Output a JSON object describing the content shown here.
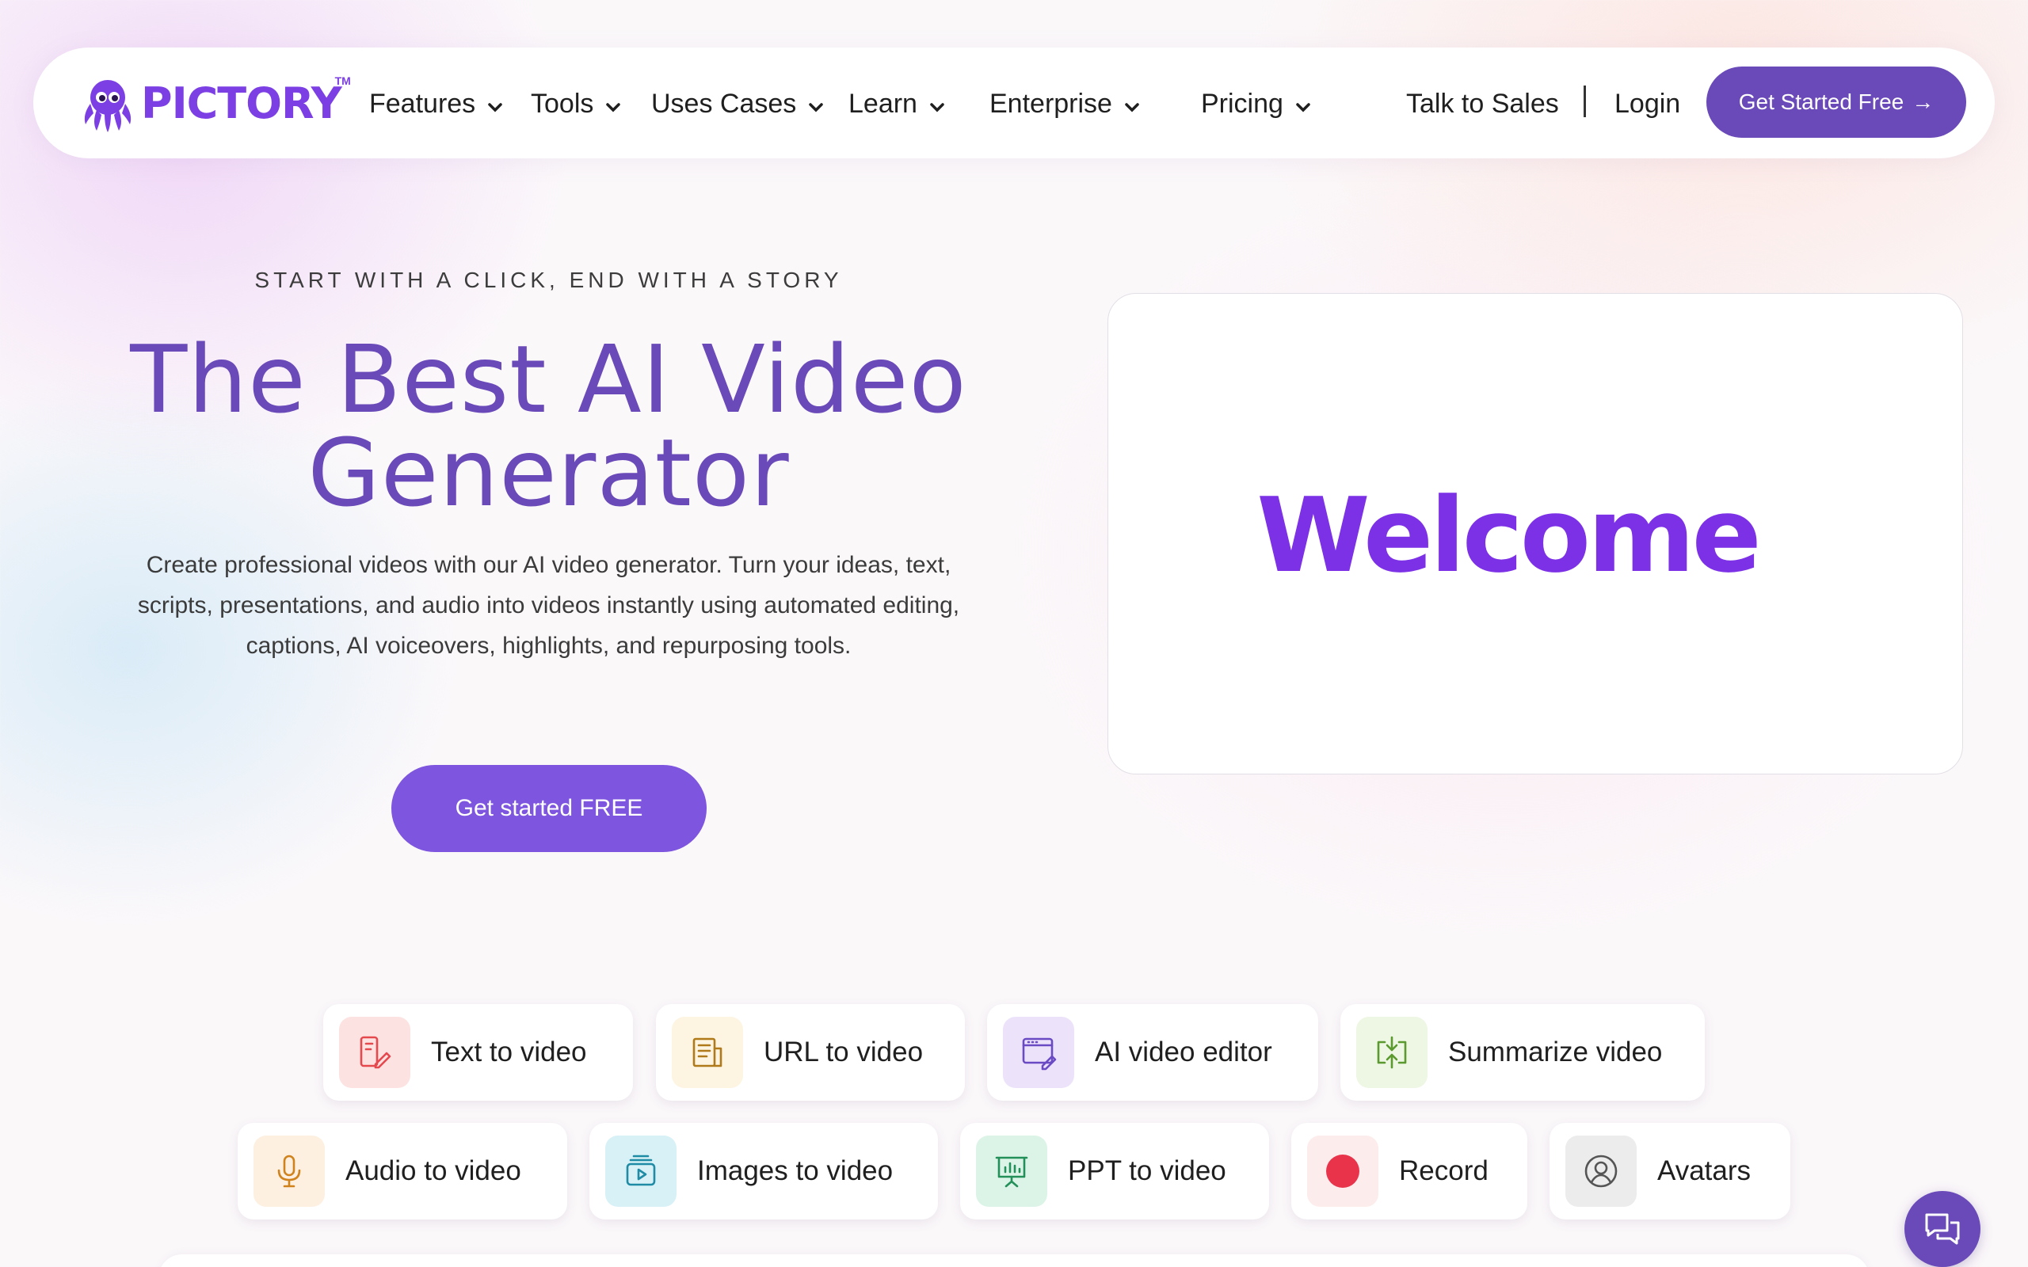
{
  "nav": {
    "logo_text": "PICTORY",
    "logo_tm": "TM",
    "menu": [
      {
        "label": "Features",
        "icon": "chevron-down-icon"
      },
      {
        "label": "Tools",
        "icon": "chevron-down-icon"
      },
      {
        "label": "Uses Cases",
        "icon": "chevron-down-icon"
      },
      {
        "label": "Learn",
        "icon": "chevron-down-icon"
      },
      {
        "label": "Enterprise",
        "icon": "chevron-down-icon"
      },
      {
        "label": "Pricing",
        "icon": "chevron-down-icon"
      }
    ],
    "talk_to_sales": "Talk to Sales",
    "login": "Login",
    "cta": "Get Started Free",
    "cta_arrow": "→"
  },
  "hero": {
    "eyebrow": "START WITH A CLICK, END WITH A STORY",
    "title_line1": "The Best AI Video",
    "title_line2": "Generator",
    "description": "Create professional videos with our AI video generator. Turn your ideas, text, scripts, presentations, and audio into videos instantly using automated editing, captions, AI voiceovers, highlights, and repurposing tools.",
    "cta": "Get started FREE"
  },
  "video": {
    "text": "Welcome"
  },
  "features": {
    "row1": [
      {
        "label": "Text to video",
        "icon": "text-edit-icon",
        "bg": "#fde2e2",
        "color": "#e5484d"
      },
      {
        "label": "URL to video",
        "icon": "document-icon",
        "bg": "#fdf4e1",
        "color": "#b07a1a"
      },
      {
        "label": "AI video editor",
        "icon": "window-edit-icon",
        "bg": "#ece3fb",
        "color": "#6b4bc4"
      },
      {
        "label": "Summarize video",
        "icon": "summarize-icon",
        "bg": "#eef6e4",
        "color": "#5a9a2e"
      }
    ],
    "row2": [
      {
        "label": "Audio to video",
        "icon": "microphone-icon",
        "bg": "#fdf0e0",
        "color": "#d0821d"
      },
      {
        "label": "Images to video",
        "icon": "images-icon",
        "bg": "#d7f1f7",
        "color": "#1f8ba5"
      },
      {
        "label": "PPT to video",
        "icon": "presentation-icon",
        "bg": "#dcf4e8",
        "color": "#23905a"
      },
      {
        "label": "Record",
        "icon": "record-icon",
        "bg": "#fdecec",
        "color": "#e8334a"
      },
      {
        "label": "Avatars",
        "icon": "avatar-icon",
        "bg": "#ececec",
        "color": "#555555"
      }
    ]
  },
  "colors": {
    "brand": "#6a4ab8",
    "logo": "#7b3fe4",
    "welcome": "#7c31e6"
  }
}
